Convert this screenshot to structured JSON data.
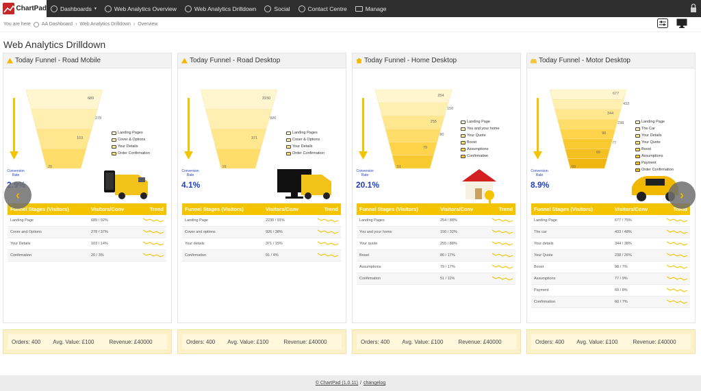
{
  "brand": {
    "name": "ChartPad"
  },
  "nav": {
    "items": [
      {
        "label": "Dashboards",
        "icon": "dashboard-icon"
      },
      {
        "label": "Web Analytics Overview",
        "icon": "dashboard-icon"
      },
      {
        "label": "Web Analytics Drilldown",
        "icon": "dashboard-icon"
      },
      {
        "label": "Social",
        "icon": "dashboard-icon"
      },
      {
        "label": "Contact Centre",
        "icon": "dashboard-icon"
      },
      {
        "label": "Manage",
        "icon": "monitor-icon"
      }
    ]
  },
  "breadcrumb": {
    "prefix": "You are here",
    "items": [
      "AA Dashboard",
      "Web Analytics Drilldown",
      "Overview"
    ]
  },
  "page": {
    "title": "Web Analytics Drilldown"
  },
  "colors": {
    "accent": "#f5c400",
    "conversion": "#2040c0",
    "summary_bg": "#fdf1c9"
  },
  "panels": [
    {
      "title": "Today Funnel - Road Mobile",
      "icon": "triangle-icon",
      "conv_label": "Conversion Rate",
      "conv_value": "2.9%",
      "funnel_numbers": [
        "689",
        "278",
        "103",
        "20"
      ],
      "legend": [
        "Landing Pages",
        "Cover & Options",
        "Your Details",
        "Order Confirmation"
      ],
      "table": {
        "headers": [
          "Funnel Stages (Visitors)",
          "Visitors/Conv",
          "Trend"
        ],
        "rows": [
          [
            "Landing Page",
            "689 / 92%"
          ],
          [
            "Cover and Options",
            "278 / 37%"
          ],
          [
            "Your Details",
            "103 / 14%"
          ],
          [
            "Confirmation",
            "20 / 3%"
          ]
        ]
      },
      "summary": {
        "orders": "Orders: 400",
        "avg": "Avg. Value: £100",
        "revenue": "Revenue: £40000"
      }
    },
    {
      "title": "Today Funnel - Road Desktop",
      "icon": "triangle-icon",
      "conv_label": "Conversion Rate",
      "conv_value": "4.1%",
      "funnel_numbers": [
        "2230",
        "926",
        "371",
        "91"
      ],
      "legend": [
        "Landing Pages",
        "Cover & Options",
        "Your Details",
        "Order Confirmation"
      ],
      "table": {
        "headers": [
          "Funnel Stages (Visitors)",
          "Visitors/Conv",
          "Trend"
        ],
        "rows": [
          [
            "Landing Page",
            "2230 / 91%"
          ],
          [
            "Cover and options",
            "926 / 38%"
          ],
          [
            "Your details",
            "371 / 15%"
          ],
          [
            "Confirmation",
            "91 / 4%"
          ]
        ]
      },
      "summary": {
        "orders": "Orders: 400",
        "avg": "Avg. Value: £100",
        "revenue": "Revenue: £40000"
      }
    },
    {
      "title": "Today Funnel - Home Desktop",
      "icon": "home-icon",
      "conv_label": "Conversion Rate",
      "conv_value": "20.1%",
      "funnel_numbers": [
        "254",
        "150",
        "255",
        "80",
        "79",
        "51"
      ],
      "legend": [
        "Landing Page",
        "You and your home",
        "Your Quote",
        "Boost",
        "Assumptions",
        "Confirmation"
      ],
      "table": {
        "headers": [
          "Funnel Stages (Visitors)",
          "Visitors/Conv",
          "Trend"
        ],
        "rows": [
          [
            "Landing Pages",
            "254 / 88%"
          ],
          [
            "You and your home",
            "150 / 32%"
          ],
          [
            "Your quote",
            "255 / 88%"
          ],
          [
            "Boost",
            "80 / 17%"
          ],
          [
            "Assumptions",
            "79 / 17%"
          ],
          [
            "Confirmation",
            "51 / 11%"
          ]
        ]
      },
      "summary": {
        "orders": "Orders: 400",
        "avg": "Avg. Value: £100",
        "revenue": "Revenue: £40000"
      }
    },
    {
      "title": "Today Funnel - Motor Desktop",
      "icon": "car-icon",
      "conv_label": "Conversion Rate",
      "conv_value": "8.9%",
      "funnel_numbers": [
        "677",
        "433",
        "344",
        "238",
        "98",
        "77",
        "69",
        "60"
      ],
      "legend": [
        "Landing Page",
        "The Car",
        "Your Details",
        "Your Quote",
        "Boost",
        "Assumptions",
        "Payment",
        "Order Confirmation"
      ],
      "table": {
        "headers": [
          "Funnel Stages (Visitors)",
          "Visitors/Conv",
          "Trend"
        ],
        "rows": [
          [
            "Landing Page",
            "677 / 75%"
          ],
          [
            "The car",
            "433 / 48%"
          ],
          [
            "Your details",
            "344 / 38%"
          ],
          [
            "Your Quote",
            "238 / 26%"
          ],
          [
            "Boost",
            "98 / 7%"
          ],
          [
            "Assumptions",
            "77 / 9%"
          ],
          [
            "Payment",
            "69 / 8%"
          ],
          [
            "Confirmation",
            "60 / 7%"
          ]
        ]
      },
      "summary": {
        "orders": "Orders: 400",
        "avg": "Avg. Value: £100",
        "revenue": "Revenue: £40000"
      }
    }
  ],
  "footer": {
    "copyright": "© ChartPad (1.0.11)",
    "separator": "/",
    "changelog": "changelog"
  }
}
